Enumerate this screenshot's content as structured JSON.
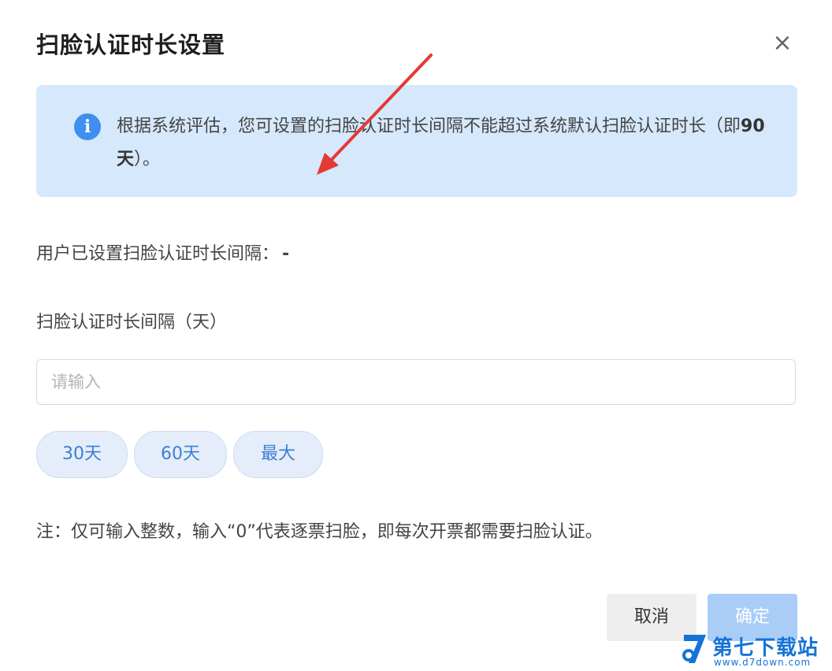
{
  "dialog": {
    "title": "扫脸认证时长设置",
    "close_glyph": "×"
  },
  "info": {
    "icon": "info-icon",
    "icon_glyph": "i",
    "text_prefix": "根据系统评估，您可设置的扫脸认证时长间隔不能超过系统默认扫脸认证时长（即",
    "text_bold": "90天",
    "text_suffix": "）。"
  },
  "user_setting": {
    "label": "用户已设置扫脸认证时长间隔：",
    "value": "-"
  },
  "field": {
    "label": "扫脸认证时长间隔（天）",
    "placeholder": "请输入",
    "value": ""
  },
  "presets": [
    {
      "label": "30天"
    },
    {
      "label": "60天"
    },
    {
      "label": "最大"
    }
  ],
  "note": "注：仅可输入整数，输入“0”代表逐票扫脸，即每次开票都需要扫脸认证。",
  "footer": {
    "cancel_label": "取消",
    "confirm_label": "确定"
  },
  "watermark": {
    "name": "第七下载站",
    "url": "www.d7down.com"
  },
  "colors": {
    "info_background": "#d6e8fb",
    "info_icon": "#3f8ef0",
    "preset_text": "#3d7fd6",
    "confirm_disabled": "#a9cdf7",
    "annotation_arrow": "#e53935",
    "watermark": "#1673d6"
  }
}
